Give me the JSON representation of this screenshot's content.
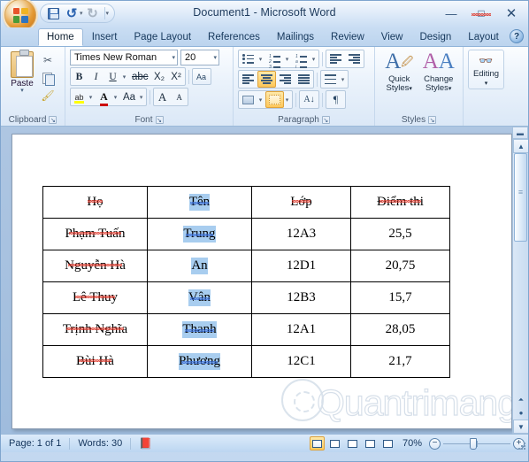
{
  "window": {
    "title": "Document1 - Microsoft Word",
    "minimize": "—",
    "maximize": "□",
    "close": "✕"
  },
  "quick_access": {
    "save": "save-icon",
    "undo": "↺",
    "undo_arrow": "▾",
    "redo": "↻",
    "customize_arrow": "▾"
  },
  "tabs": [
    {
      "label": "Home",
      "active": true
    },
    {
      "label": "Insert",
      "active": false
    },
    {
      "label": "Page Layout",
      "active": false
    },
    {
      "label": "References",
      "active": false
    },
    {
      "label": "Mailings",
      "active": false
    },
    {
      "label": "Review",
      "active": false
    },
    {
      "label": "View",
      "active": false
    },
    {
      "label": "Design",
      "active": false
    },
    {
      "label": "Layout",
      "active": false
    }
  ],
  "help_button": "?",
  "ribbon": {
    "clipboard": {
      "label": "Clipboard",
      "paste": "Paste",
      "paste_arrow": "▾",
      "cut": "✂",
      "copy": "copy-icon",
      "format_painter": "🖌",
      "launcher": "↘"
    },
    "font": {
      "label": "Font",
      "font_name": "Times New Roman",
      "font_size": "20",
      "bold": "B",
      "italic": "I",
      "underline": "U",
      "underline_arrow": "▾",
      "strikethrough": "abc",
      "subscript": "X₂",
      "superscript": "X²",
      "clear_formatting": "Aa",
      "highlight": "ab",
      "highlight_arrow": "▾",
      "font_color": "A",
      "font_color_arrow": "▾",
      "change_case": "Aa",
      "change_case_arrow": "▾",
      "grow_font": "A",
      "shrink_font": "A",
      "launcher": "↘"
    },
    "paragraph": {
      "label": "Paragraph",
      "bullets": "bullets-icon",
      "bullets_arrow": "▾",
      "numbering": "numbering-icon",
      "numbering_arrow": "▾",
      "multilevel": "multilevel-icon",
      "multilevel_arrow": "▾",
      "decrease_indent": "decrease-indent-icon",
      "increase_indent": "increase-indent-icon",
      "align_left": "align-left-icon",
      "align_center": "align-center-icon",
      "align_right": "align-right-icon",
      "justify": "justify-icon",
      "line_spacing": "line-spacing-icon",
      "line_spacing_arrow": "▾",
      "shading": "shading-icon",
      "shading_arrow": "▾",
      "borders": "borders-icon",
      "borders_arrow": "▾",
      "sort": "A\nZ",
      "show_marks": "¶",
      "launcher": "↘"
    },
    "styles": {
      "label": "Styles",
      "quick_styles": "Quick",
      "quick_styles2": "Styles",
      "change_styles": "Change",
      "change_styles2": "Styles",
      "arrow": "▾",
      "launcher": "↘"
    },
    "editing": {
      "label": "Editing",
      "binoculars": "🔍",
      "arrow": "▾"
    }
  },
  "document": {
    "table": {
      "headers": [
        "Họ",
        "Tên",
        "Lớp",
        "Điểm thi"
      ],
      "rows": [
        [
          "Phạm Tuấn",
          "Trung",
          "12A3",
          "25,5"
        ],
        [
          "Nguyễn Hà",
          "An",
          "12D1",
          "20,75"
        ],
        [
          "Lê Thuy",
          "Vân",
          "12B3",
          "15,7"
        ],
        [
          "Trịnh Nghĩa",
          "Thanh",
          "12A1",
          "28,05"
        ],
        [
          "Bùi Hà",
          "Phương",
          "12C1",
          "21,7"
        ]
      ],
      "selected_column_index": 1
    },
    "watermark": "Quantrimang"
  },
  "scrollbar": {
    "split": "▬",
    "up": "▲",
    "down": "▼",
    "prev_page": "⏶",
    "select_object": "●",
    "next_page": "⏷"
  },
  "statusbar": {
    "page": "Page: 1 of 1",
    "words": "Words: 30",
    "proofing": "proofing-errors-icon",
    "views": [
      {
        "name": "print-layout",
        "active": true
      },
      {
        "name": "full-screen-reading",
        "active": false
      },
      {
        "name": "web-layout",
        "active": false
      },
      {
        "name": "outline",
        "active": false
      },
      {
        "name": "draft",
        "active": false
      }
    ],
    "zoom": "70%",
    "zoom_out": "−",
    "zoom_in": "+"
  }
}
